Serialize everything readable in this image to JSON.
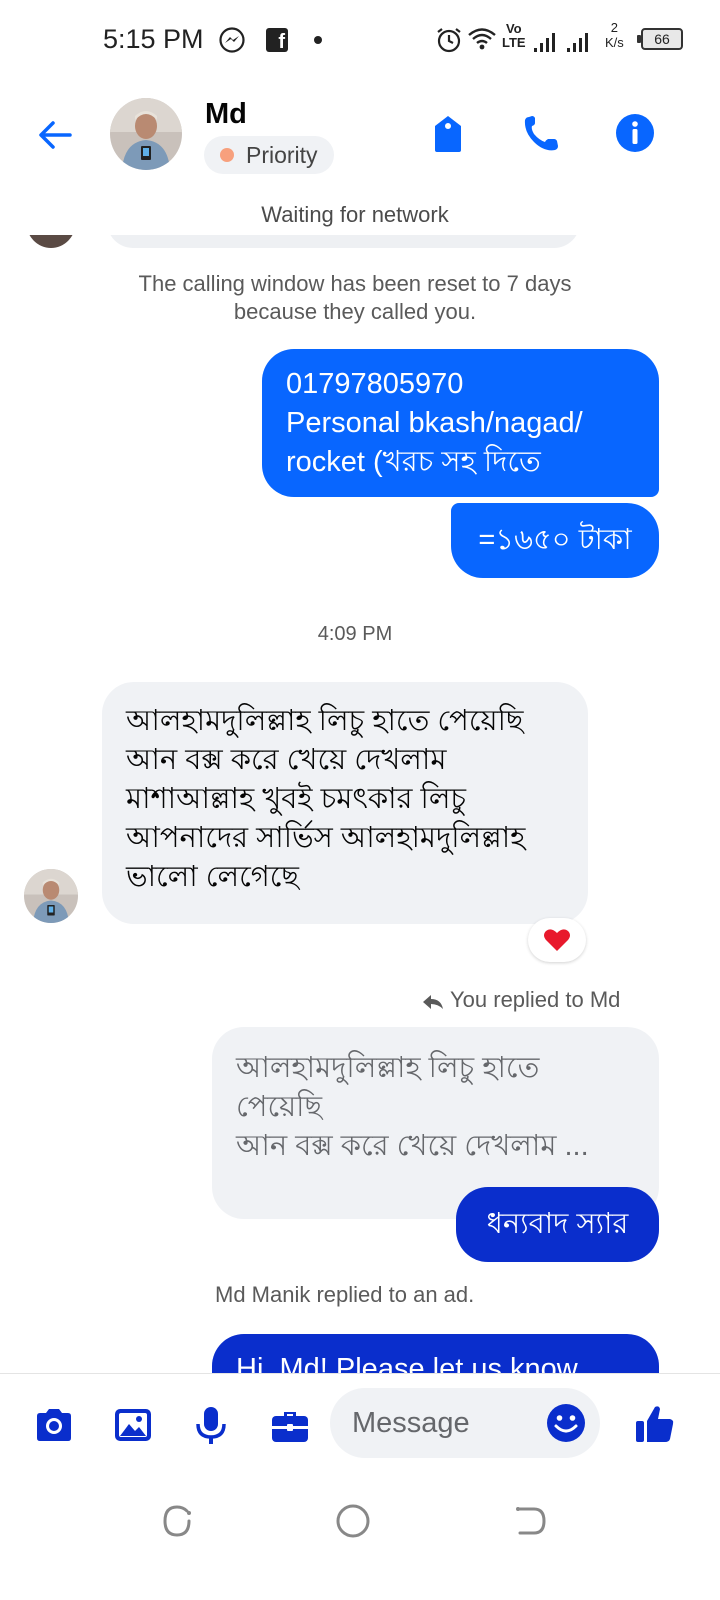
{
  "status_bar": {
    "time": "5:15 PM",
    "volte_top": "Vo",
    "volte_bottom": "LTE",
    "speed_value": "2",
    "speed_unit": "K/s",
    "battery": "66"
  },
  "header": {
    "contact_name": "Md",
    "priority_label": "Priority",
    "accent_color": "#0866ff"
  },
  "network_status": "Waiting for network",
  "chat": {
    "system_notice": [
      "The calling window has been reset to 7 days",
      "because they called you."
    ],
    "outgoing_1": [
      "01797805970",
      "Personal bkash/nagad/",
      "rocket (খরচ সহ দিতে"
    ],
    "outgoing_2": "=১৬৫০ টাকা",
    "timestamp": "4:09 PM",
    "incoming_1": [
      "আলহামদুলিল্লাহ লিচু হাতে পেয়েছি",
      "আন বক্স করে খেয়ে দেখলাম",
      "মাশাআল্লাহ খুবই চমৎকার লিচু",
      "আপনাদের সার্ভিস আলহামদুলিল্লাহ",
      "ভালো লেগেছে"
    ],
    "reaction": "❤",
    "reply_label": "You replied to Md",
    "quoted_reply": [
      "আলহামদুলিল্লাহ লিচু হাতে",
      "পেয়েছি",
      "আন বক্স করে খেয়ে দেখলাম ..."
    ],
    "reply_message": "ধন্যবাদ স্যার",
    "ad_notice": "Md Manik replied to an ad.",
    "ad_message": "Hi, Md! Please let us know"
  },
  "composer": {
    "placeholder": "Message",
    "icon_color": "#0a2ecc"
  }
}
